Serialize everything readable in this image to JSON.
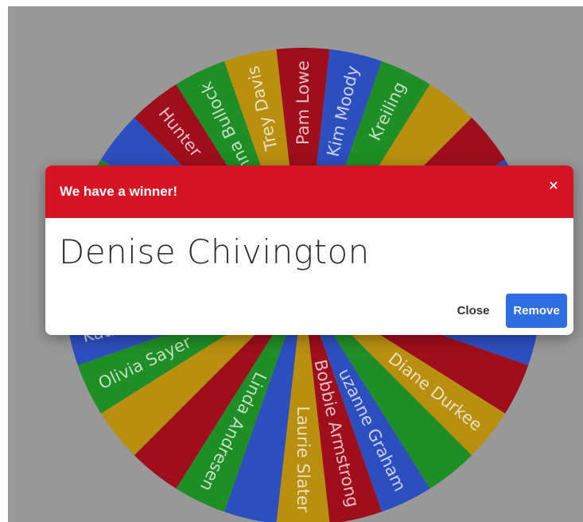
{
  "wheel": {
    "segment_colors": [
      "#9e0e1c",
      "#1f8e26",
      "#b88f0f",
      "#2d4fbe"
    ],
    "visible_names": [
      "Pam Lowe",
      "Kim Moody",
      "Kreiling",
      "Trey Davis",
      "anna Bullock",
      "Hunter",
      "Kathi Brown",
      "Olivia Sayer",
      "Linda Andresen",
      "Laurie Slater",
      "Bobbie Armstrong",
      "uzanne Graham",
      "Diane Durkee"
    ]
  },
  "modal": {
    "title": "We have a winner!",
    "close_icon": "×",
    "winner": "Denise Chivington",
    "close_label": "Close",
    "remove_label": "Remove",
    "header_color": "#d61426",
    "button_color": "#2f6ee0"
  }
}
